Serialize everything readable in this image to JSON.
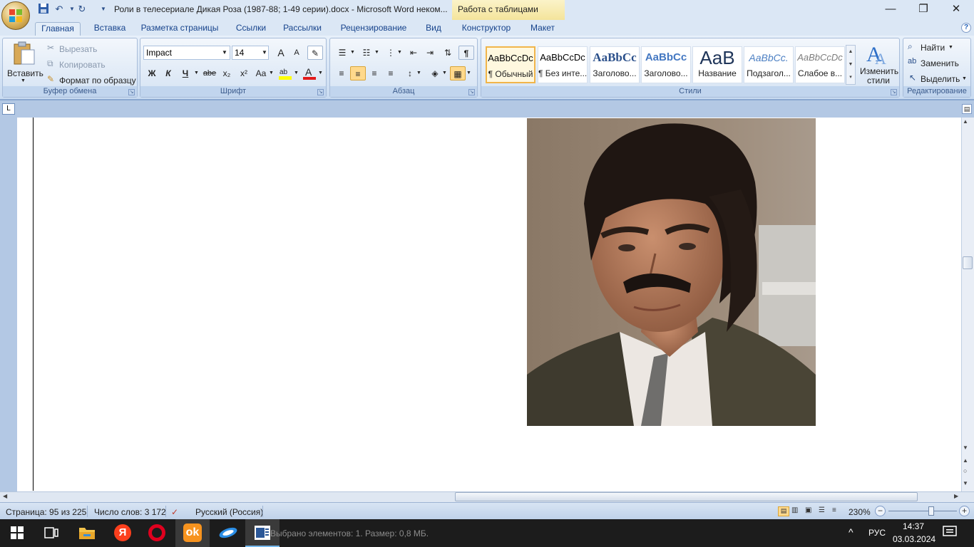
{
  "titlebar": {
    "title": "Роли в телесериале Дикая Роза (1987-88; 1-49 серии).docx - Microsoft Word неком...",
    "context_tab": "Работа с таблицами",
    "undo_icon": "↶",
    "redo_icon": "↻",
    "minimize": "—",
    "maximize": "❐",
    "close": "✕"
  },
  "tabs": [
    "Главная",
    "Вставка",
    "Разметка страницы",
    "Ссылки",
    "Рассылки",
    "Рецензирование",
    "Вид",
    "Конструктор",
    "Макет"
  ],
  "clipboard": {
    "paste": "Вставить",
    "cut": "Вырезать",
    "copy": "Копировать",
    "format_painter": "Формат по образцу",
    "label": "Буфер обмена"
  },
  "font": {
    "name": "Impact",
    "size": "14",
    "bold": "Ж",
    "italic": "К",
    "underline": "Ч",
    "strike": "abe",
    "subscript": "x₂",
    "superscript": "x²",
    "change_case": "Aa",
    "grow": "A",
    "shrink": "A",
    "label": "Шрифт"
  },
  "paragraph": {
    "label": "Абзац",
    "pilcrow": "¶"
  },
  "styles": {
    "items": [
      {
        "preview": "AaBbCcDc",
        "name": "¶ Обычный"
      },
      {
        "preview": "AaBbCcDc",
        "name": "¶ Без инте..."
      },
      {
        "preview": "AaBbCc",
        "name": "Заголово..."
      },
      {
        "preview": "AaBbCc",
        "name": "Заголово..."
      },
      {
        "preview": "AaB",
        "name": "Название"
      },
      {
        "preview": "AaBbCc.",
        "name": "Подзагол..."
      },
      {
        "preview": "AaBbCcDc",
        "name": "Слабое в..."
      }
    ],
    "change_styles": "Изменить стили",
    "label": "Стили"
  },
  "editing": {
    "find": "Найти",
    "replace": "Заменить",
    "select": "Выделить",
    "label": "Редактирование"
  },
  "ruler": {
    "tab_selector": "L"
  },
  "statusbar": {
    "page": "Страница: 95 из 225",
    "words": "Число слов: 3 172",
    "language": "Русский (Россия)",
    "zoom": "230%"
  },
  "taskbar": {
    "hidden_text": "Выбрано элементов: 1. Размер: 0,8 МБ.",
    "lang": "РУС",
    "time": "14:37",
    "date": "03.03.2024"
  },
  "colors": {
    "accent": "#15428b",
    "ribbon_bg": "#dbe7f5",
    "selected_style": "#f1b54a"
  }
}
